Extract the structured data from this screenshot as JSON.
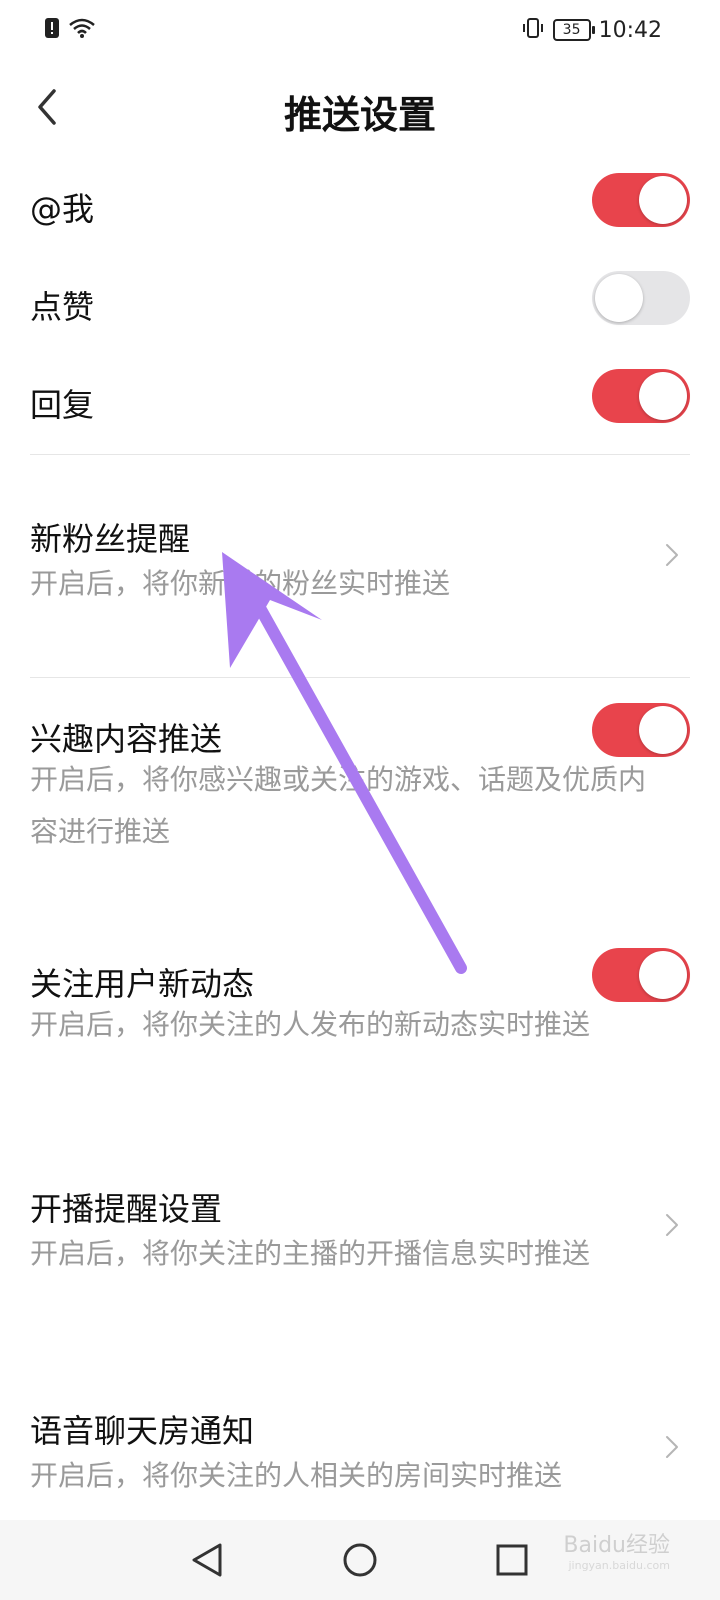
{
  "status_bar": {
    "time": "10:42",
    "battery": "35"
  },
  "header": {
    "title": "推送设置"
  },
  "settings": [
    {
      "label": "@我",
      "type": "toggle",
      "state": "on"
    },
    {
      "label": "点赞",
      "type": "toggle",
      "state": "off"
    },
    {
      "label": "回复",
      "type": "toggle",
      "state": "on"
    },
    {
      "label": "新粉丝提醒",
      "type": "link",
      "desc": "开启后，将你新增的粉丝实时推送"
    },
    {
      "label": "兴趣内容推送",
      "type": "toggle",
      "state": "on",
      "desc": "开启后，将你感兴趣或关注的游戏、话题及优质内容进行推送"
    },
    {
      "label": "关注用户新动态",
      "type": "toggle",
      "state": "on",
      "desc": "开启后，将你关注的人发布的新动态实时推送"
    },
    {
      "label": "开播提醒设置",
      "type": "link",
      "desc": "开启后，将你关注的主播的开播信息实时推送"
    },
    {
      "label": "语音聊天房通知",
      "type": "link",
      "desc": "开启后，将你关注的人相关的房间实时推送"
    }
  ],
  "colors": {
    "toggle_on": "#e8444c",
    "toggle_off": "#e5e5e7",
    "annotation_arrow": "#a97af0"
  },
  "watermark": {
    "text": "Baidu经验",
    "sub": "jingyan.baidu.com"
  }
}
